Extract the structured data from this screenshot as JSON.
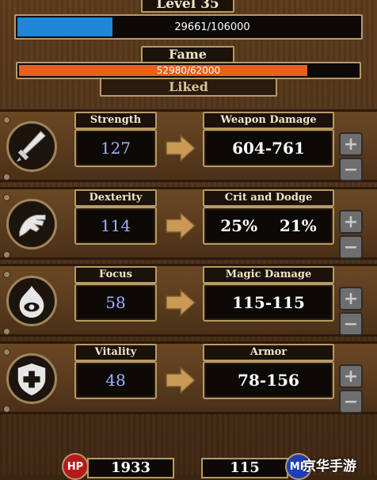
{
  "level": {
    "title": "Level 35",
    "xp_text": "29661/106000",
    "xp_fraction": 0.28,
    "xp_color": "#1f86d8"
  },
  "fame": {
    "title": "Fame",
    "value_text": "52980/62000",
    "fraction": 0.854,
    "color": "#e8601b",
    "status": "Liked"
  },
  "stats": [
    {
      "icon": "sword-icon",
      "name": "Strength",
      "value": "127",
      "result_name": "Weapon Damage",
      "result_value": "604-761"
    },
    {
      "icon": "hand-icon",
      "name": "Dexterity",
      "value": "114",
      "result_name": "Crit and Dodge",
      "result_value": "25%    21%"
    },
    {
      "icon": "eye-flame-icon",
      "name": "Focus",
      "value": "58",
      "result_name": "Magic Damage",
      "result_value": "115-115"
    },
    {
      "icon": "shield-icon",
      "name": "Vitality",
      "value": "48",
      "result_name": "Armor",
      "result_value": "78-156"
    }
  ],
  "buttons": {
    "plus": "+",
    "minus": "−"
  },
  "bottom": {
    "hp_label": "HP",
    "hp_value": "1933",
    "mp_label": "MP",
    "mp_value": "115"
  },
  "watermark": "京华手游",
  "colors": {
    "stat_value": "#9fb2ff",
    "border": "#b79a66",
    "hp_orb": "#b51a1a",
    "mp_orb": "#1f3fb8"
  }
}
